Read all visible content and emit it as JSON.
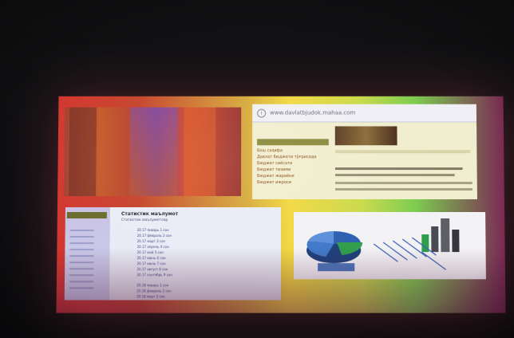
{
  "browser": {
    "url": "www.davlatbjudok.mahaa.com",
    "menu_items": [
      "Бош саҳифа",
      "Давлат бюджети тўғрисида",
      "Бюджет сиёсати",
      "Бюджет тизими",
      "Бюджет жараёни",
      "Бюджет ижроси"
    ]
  },
  "stats": {
    "title": "Статистик маълумот",
    "subtitle": "Статистик маълумотлар",
    "rows": [
      "20.17 январь 1 сон",
      "20.17 февраль 2 сон",
      "20.17 март 3 сон",
      "20.17 апрель 4 сон",
      "20.17 май 5 сон",
      "20.17 июнь 6 сон",
      "20.17 июль 7 сон",
      "20.17 август 8 сон",
      "20.17 сентябрь 9 сон",
      "20.18 январь 1 сон",
      "20.18 февраль 2 сон",
      "20.18 март 3 сон"
    ]
  },
  "colors": {
    "projection_left": "#d3372f",
    "projection_mid": "#f2d83f",
    "projection_right": "#7b2a55",
    "pie_blue": "#2b5fb0",
    "pie_green": "#2f9e4a"
  }
}
